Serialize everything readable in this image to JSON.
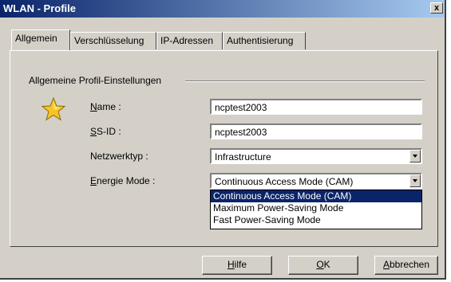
{
  "window": {
    "title": "WLAN - Profile",
    "close_label": "x"
  },
  "tabs": [
    {
      "label": "Allgemein",
      "active": true
    },
    {
      "label": "Verschlüsselung",
      "active": false
    },
    {
      "label": "IP-Adressen",
      "active": false
    },
    {
      "label": "Authentisierung",
      "active": false
    }
  ],
  "group": {
    "title": "Allgemeine Profil-Einstellungen"
  },
  "form": {
    "name_label_ul": "N",
    "name_label_rest": "ame :",
    "name_value": "ncptest2003",
    "ssid_label_ul": "S",
    "ssid_label_rest": "S-ID :",
    "ssid_value": "ncptest2003",
    "nettype_label": "Netzwerktyp :",
    "nettype_value": "Infrastructure",
    "energy_label_ul": "E",
    "energy_label_rest": "nergie Mode :",
    "energy_value": "Continuous Access Mode (CAM)"
  },
  "dropdown": {
    "options": [
      "Continuous Access Mode (CAM)",
      "Maximum Power-Saving Mode",
      "Fast Power-Saving Mode"
    ],
    "selected_index": 0
  },
  "buttons": {
    "help_ul": "H",
    "help_rest": "ilfe",
    "ok_ul": "O",
    "ok_rest": "K",
    "cancel_ul": "A",
    "cancel_rest": "bbrechen"
  },
  "colors": {
    "face": "#d4d0c8",
    "titlebar_start": "#0a246a",
    "titlebar_end": "#a6caf0",
    "selection": "#0a246a",
    "star": "#f7c528"
  }
}
